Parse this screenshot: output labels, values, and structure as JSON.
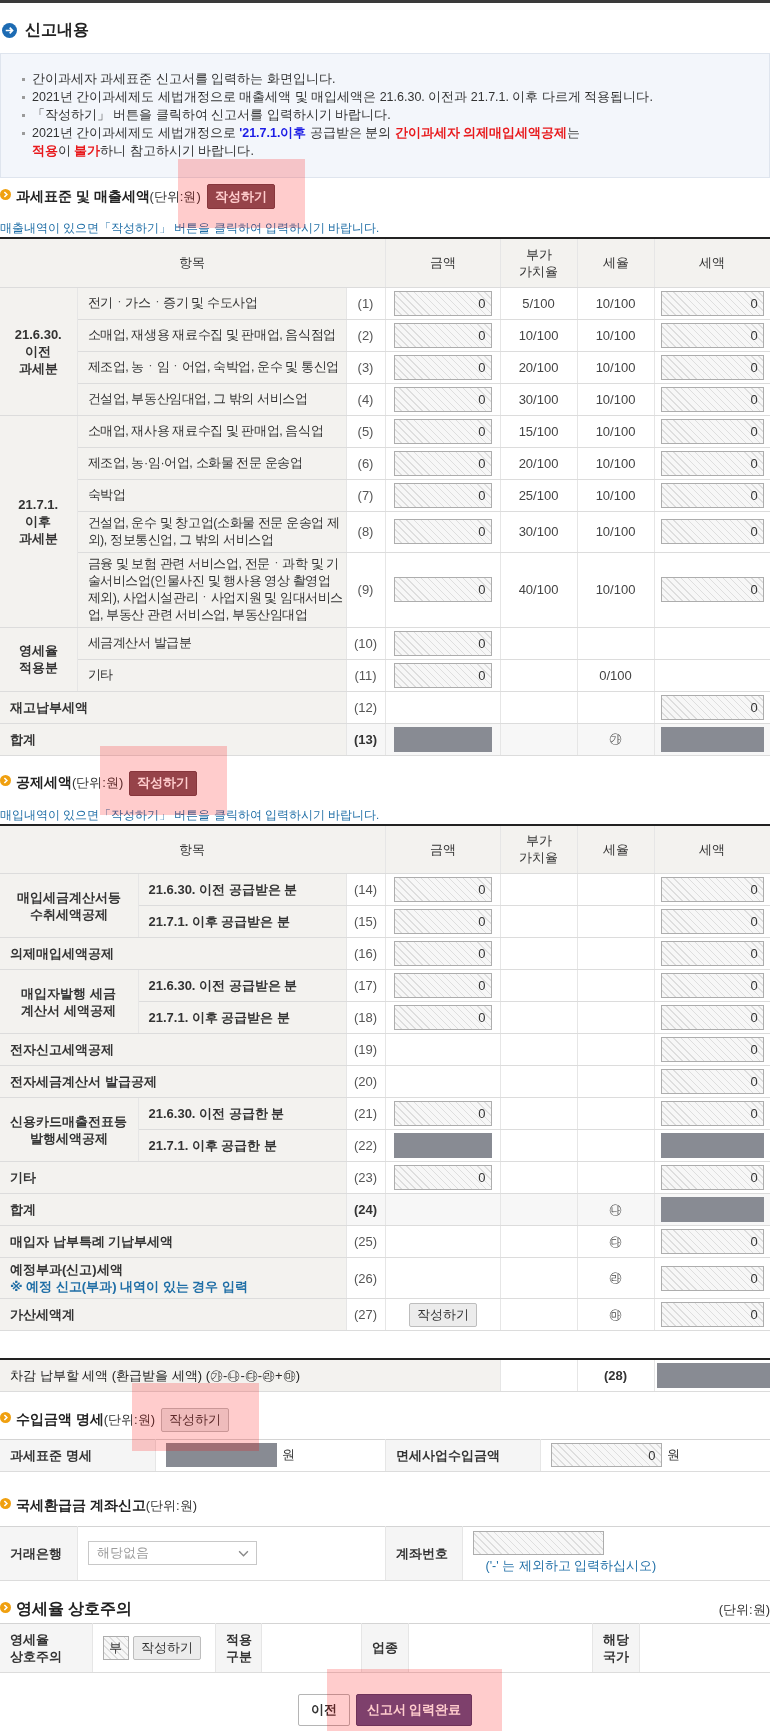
{
  "page_title": "신고내용",
  "notice": {
    "items": [
      {
        "lines": [
          [
            {
              "text": "간이과세자 과세표준 신고서를 입력하는 화면입니다.",
              "kind": "plain"
            }
          ]
        ]
      },
      {
        "lines": [
          [
            {
              "text": "2021년 간이과세제도 세법개정으로 매출세액 및 매입세액은 21.6.30. 이전과 21.7.1. 이후 다르게 적용됩니다.",
              "kind": "plain"
            }
          ]
        ]
      },
      {
        "lines": [
          [
            {
              "text": "「작성하기」 버튼을 클릭하여 신고서를 입력하시기 바랍니다.",
              "kind": "plain"
            }
          ]
        ]
      },
      {
        "lines": [
          [
            {
              "text": "2021년 간이과세제도 세법개정으로 ",
              "kind": "plain"
            },
            {
              "text": "'21.7.1.이후",
              "kind": "info"
            },
            {
              "text": " 공급받은 분의 ",
              "kind": "plain"
            },
            {
              "text": "간이과세자 의제매입세액공제",
              "kind": "alert"
            },
            {
              "text": "는",
              "kind": "plain"
            }
          ],
          [
            {
              "text": "적용",
              "kind": "alert"
            },
            {
              "text": "이 ",
              "kind": "plain"
            },
            {
              "text": "불가",
              "kind": "alert"
            },
            {
              "text": "하니 참고하시기 바랍니다.",
              "kind": "plain"
            }
          ]
        ]
      }
    ]
  },
  "sales": {
    "title": "과세표준 및 매출세액",
    "unit": "(단위:원)",
    "write_button": {
      "label": "작성하기",
      "kind": "dark",
      "highlighted": true
    },
    "hint": "매출내역이 있으면「작성하기」 버튼을 클릭하여 입력하시기 바랍니다.",
    "columns": [
      "항목",
      "금액",
      "부가\n가치율",
      "세율",
      "세액"
    ],
    "rows": [
      {
        "kind": "group",
        "label": "21.6.30.\n이전\n과세분",
        "items": [
          {
            "label": "전기ㆍ가스ㆍ증기 및 수도사업",
            "number": "(1)",
            "amount": {
              "kind": "input",
              "value": "0"
            },
            "value_rate": "5/100",
            "tax_rate": "10/100",
            "tax": {
              "kind": "input",
              "value": "0"
            }
          },
          {
            "label": "소매업, 재생용 재료수집 및 판매업, 음식점업",
            "number": "(2)",
            "amount": {
              "kind": "input",
              "value": "0"
            },
            "value_rate": "10/100",
            "tax_rate": "10/100",
            "tax": {
              "kind": "input",
              "value": "0"
            }
          },
          {
            "label": "제조업, 농ㆍ임ㆍ어업, 숙박업, 운수 및 통신업",
            "number": "(3)",
            "amount": {
              "kind": "input",
              "value": "0"
            },
            "value_rate": "20/100",
            "tax_rate": "10/100",
            "tax": {
              "kind": "input",
              "value": "0"
            }
          },
          {
            "label": "건설업, 부동산임대업, 그 밖의 서비스업",
            "number": "(4)",
            "amount": {
              "kind": "input",
              "value": "0"
            },
            "value_rate": "30/100",
            "tax_rate": "10/100",
            "tax": {
              "kind": "input",
              "value": "0"
            }
          }
        ]
      },
      {
        "kind": "group",
        "label": "21.7.1.\n이후\n과세분",
        "items": [
          {
            "label": "소매업, 재사용 재료수집 및 판매업, 음식업",
            "number": "(5)",
            "amount": {
              "kind": "input",
              "value": "0"
            },
            "value_rate": "15/100",
            "tax_rate": "10/100",
            "tax": {
              "kind": "input",
              "value": "0"
            }
          },
          {
            "label": "제조업, 농·임·어업, 소화물 전문 운송업",
            "number": "(6)",
            "amount": {
              "kind": "input",
              "value": "0"
            },
            "value_rate": "20/100",
            "tax_rate": "10/100",
            "tax": {
              "kind": "input",
              "value": "0"
            }
          },
          {
            "label": "숙박업",
            "number": "(7)",
            "amount": {
              "kind": "input",
              "value": "0"
            },
            "value_rate": "25/100",
            "tax_rate": "10/100",
            "tax": {
              "kind": "input",
              "value": "0"
            }
          },
          {
            "label": "건설업, 운수 및 창고업(소화물 전문 운송업 제외), 정보통신업, 그 밖의 서비스업",
            "number": "(8)",
            "amount": {
              "kind": "input",
              "value": "0"
            },
            "value_rate": "30/100",
            "tax_rate": "10/100",
            "tax": {
              "kind": "input",
              "value": "0"
            }
          },
          {
            "label": "금융 및 보험 관련 서비스업, 전문ㆍ과학 및 기술서비스업(인물사진 및 행사용 영상 촬영업 제외), 사업시설관리ㆍ사업지원 및 임대서비스업, 부동산 관련 서비스업, 부동산임대업",
            "number": "(9)",
            "amount": {
              "kind": "input",
              "value": "0"
            },
            "value_rate": "40/100",
            "tax_rate": "10/100",
            "tax": {
              "kind": "input",
              "value": "0"
            }
          }
        ]
      },
      {
        "kind": "group",
        "label": "영세율\n적용분",
        "items": [
          {
            "label": "세금계산서 발급분",
            "number": "(10)",
            "amount": {
              "kind": "input",
              "value": "0"
            }
          },
          {
            "label": "기타",
            "number": "(11)",
            "amount": {
              "kind": "input",
              "value": "0"
            },
            "tax_rate": "0/100"
          }
        ]
      },
      {
        "kind": "item",
        "label": "재고납부세액",
        "number": "(12)",
        "tax": {
          "kind": "input",
          "value": "0"
        }
      },
      {
        "kind": "total",
        "label": "합계",
        "number": "(13)",
        "amount": {
          "kind": "masked"
        },
        "tax_rate": "㉮",
        "tax": {
          "kind": "masked"
        }
      }
    ]
  },
  "deduction": {
    "title": "공제세액",
    "unit": "(단위:원)",
    "write_button": {
      "label": "작성하기",
      "kind": "dark",
      "highlighted": true
    },
    "hint": "매입내역이 있으면「작성하기」 버튼을 클릭하여 입력하시기 바랍니다.",
    "columns": [
      "항목",
      "금액",
      "부가\n가치율",
      "세율",
      "세액"
    ],
    "rows": [
      {
        "kind": "group",
        "label": "매입세금계산서등\n수취세액공제",
        "items": [
          {
            "label": "21.6.30. 이전 공급받은 분",
            "number": "(14)",
            "amount": {
              "kind": "input",
              "value": "0"
            },
            "tax": {
              "kind": "input",
              "value": "0"
            }
          },
          {
            "label": "21.7.1. 이후 공급받은 분",
            "number": "(15)",
            "amount": {
              "kind": "input",
              "value": "0"
            },
            "tax": {
              "kind": "input",
              "value": "0"
            }
          }
        ]
      },
      {
        "kind": "item",
        "label": "의제매입세액공제",
        "number": "(16)",
        "amount": {
          "kind": "input",
          "value": "0"
        },
        "tax": {
          "kind": "input",
          "value": "0"
        }
      },
      {
        "kind": "group",
        "label": "매입자발행 세금\n계산서 세액공제",
        "items": [
          {
            "label": "21.6.30. 이전 공급받은 분",
            "number": "(17)",
            "amount": {
              "kind": "input",
              "value": "0"
            },
            "tax": {
              "kind": "input",
              "value": "0"
            }
          },
          {
            "label": "21.7.1. 이후 공급받은 분",
            "number": "(18)",
            "amount": {
              "kind": "input",
              "value": "0"
            },
            "tax": {
              "kind": "input",
              "value": "0"
            }
          }
        ]
      },
      {
        "kind": "item",
        "label": "전자신고세액공제",
        "number": "(19)",
        "tax": {
          "kind": "input",
          "value": "0"
        }
      },
      {
        "kind": "item",
        "label": "전자세금계산서 발급공제",
        "number": "(20)",
        "tax": {
          "kind": "input",
          "value": "0"
        }
      },
      {
        "kind": "group",
        "label": "신용카드매출전표등\n발행세액공제",
        "items": [
          {
            "label": "21.6.30. 이전 공급한 분",
            "number": "(21)",
            "amount": {
              "kind": "input",
              "value": "0"
            },
            "tax": {
              "kind": "input",
              "value": "0"
            }
          },
          {
            "label": "21.7.1. 이후 공급한 분",
            "number": "(22)",
            "amount": {
              "kind": "masked"
            },
            "tax": {
              "kind": "masked"
            }
          }
        ]
      },
      {
        "kind": "item",
        "label": "기타",
        "number": "(23)",
        "amount": {
          "kind": "input",
          "value": "0"
        },
        "tax": {
          "kind": "input",
          "value": "0"
        }
      },
      {
        "kind": "total",
        "label": "합계",
        "number": "(24)",
        "tax_rate": "㉯",
        "tax": {
          "kind": "masked"
        }
      },
      {
        "kind": "item",
        "label": "매입자 납부특례 기납부세액",
        "number": "(25)",
        "tax_rate": "㉰",
        "tax": {
          "kind": "input",
          "value": "0"
        }
      },
      {
        "kind": "item",
        "label": "예정부과(신고)세액",
        "note": "※ 예정 신고(부과) 내역이 있는 경우 입력",
        "number": "(26)",
        "tax_rate": "㉱",
        "tax": {
          "kind": "input",
          "value": "0"
        }
      },
      {
        "kind": "item",
        "label": "가산세액계",
        "number": "(27)",
        "write_button": {
          "label": "작성하기",
          "kind": "light",
          "highlighted": false
        },
        "tax_rate": "㉲",
        "tax": {
          "kind": "input",
          "value": "0"
        }
      }
    ]
  },
  "net_tax": {
    "label": "차감 납부할 세액 (환급받을 세액) (㉮-㉯-㉰-㉱+㉲)",
    "number": "(28)",
    "tax": {
      "kind": "masked"
    }
  },
  "income": {
    "title": "수입금액 명세",
    "unit": "(단위:원)",
    "write_button": {
      "label": "작성하기",
      "kind": "light",
      "highlighted": true
    },
    "fields": [
      {
        "label": "과세표준 명세",
        "field": {
          "kind": "masked"
        },
        "suffix": "원"
      },
      {
        "label": "면세사업수입금액",
        "field": {
          "kind": "input",
          "value": "0"
        },
        "suffix": "원"
      }
    ]
  },
  "refund_account": {
    "title": "국세환급금 계좌신고",
    "unit": "(단위:원)",
    "bank": {
      "label": "거래은행",
      "placeholder": "해당없음"
    },
    "account": {
      "label": "계좌번호",
      "field": {
        "kind": "input"
      },
      "note": "('-' 는 제외하고 입력하십시오)"
    }
  },
  "zero_rate": {
    "title": "영세율 상호주의",
    "unit": "(단위:원)",
    "label": "영세율\n상호주의",
    "value": {
      "kind": "input",
      "value": "부"
    },
    "write_button": {
      "label": "작성하기",
      "kind": "light",
      "highlighted": false
    },
    "fields": [
      {
        "label": "적용\n구분"
      },
      {
        "label": "업종"
      },
      {
        "label": "해당\n국가"
      }
    ]
  },
  "actions": [
    {
      "label": "이전",
      "kind": "secondary",
      "highlighted": false
    },
    {
      "label": "신고서 입력완료",
      "kind": "primary",
      "highlighted": true
    }
  ]
}
